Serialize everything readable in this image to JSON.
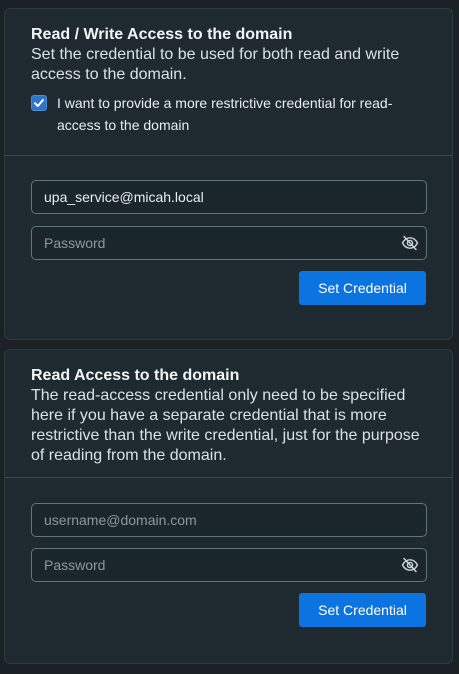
{
  "write_panel": {
    "title": "Read / Write Access to the domain",
    "description": "Set the credential to be used for both read and write access to the domain.",
    "checkbox": {
      "checked": true,
      "label": "I want to provide a more restrictive credential for read-access to the domain"
    },
    "username": {
      "value": "upa_service@micah.local",
      "placeholder": ""
    },
    "password": {
      "value": "",
      "placeholder": "Password"
    },
    "button_label": "Set Credential"
  },
  "read_panel": {
    "title": "Read Access to the domain",
    "description": "The read-access credential only need to be specified here if you have a separate credential that is more restrictive than the write credential, just for the purpose of reading from the domain.",
    "username": {
      "value": "",
      "placeholder": "username@domain.com"
    },
    "password": {
      "value": "",
      "placeholder": "Password"
    },
    "button_label": "Set Credential"
  },
  "icons": {
    "password_toggle": "eye-slash-icon",
    "checkbox_mark": "checkmark-icon"
  },
  "colors": {
    "accent": "#0b74e0",
    "panel_bg": "#1f2a30",
    "page_bg": "#1b2124"
  }
}
